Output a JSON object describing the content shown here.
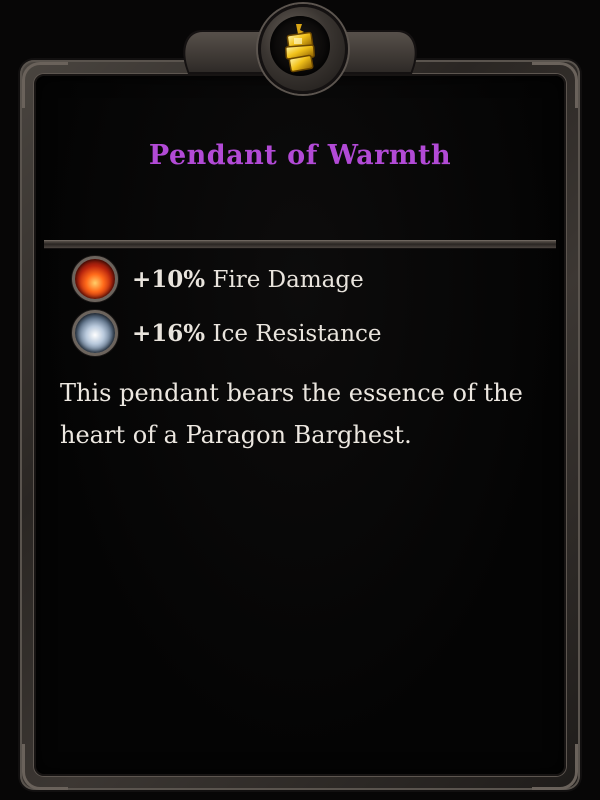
{
  "item": {
    "name": "Pendant of Warmth",
    "name_color": "#b24ad6",
    "icon": "gold-pendant-icon"
  },
  "stats": [
    {
      "value": "+10%",
      "label": "Fire Damage",
      "icon": "fire-element-icon"
    },
    {
      "value": "+16%",
      "label": "Ice Resistance",
      "icon": "ice-element-icon"
    }
  ],
  "description": "This pendant bears the essence of the heart of a Paragon Barghest."
}
